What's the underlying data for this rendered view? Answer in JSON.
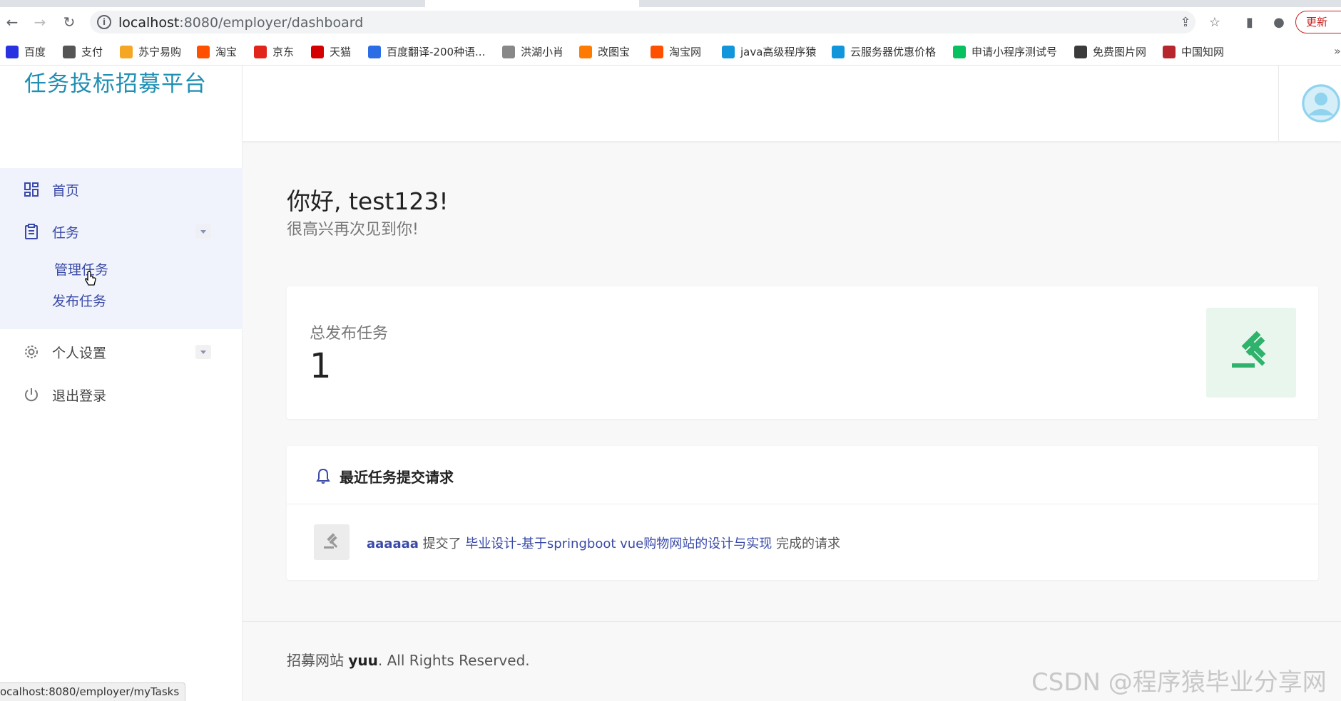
{
  "browser": {
    "url_host": "localhost",
    "url_path": ":8080/employer/dashboard",
    "update_label": "更新",
    "bookmarks": [
      {
        "label": "百度",
        "color": "#2932e1"
      },
      {
        "label": "支付",
        "color": "#555555"
      },
      {
        "label": "苏宁易购",
        "color": "#f5a623"
      },
      {
        "label": "淘宝",
        "color": "#ff5000"
      },
      {
        "label": "京东",
        "color": "#e1251b"
      },
      {
        "label": "天猫",
        "color": "#d40000"
      },
      {
        "label": "百度翻译-200种语...",
        "color": "#2b6de5"
      },
      {
        "label": "洪湖小肖",
        "color": "#888888"
      },
      {
        "label": "改图宝",
        "color": "#ff7a00"
      },
      {
        "label": "淘宝网",
        "color": "#ff5000"
      },
      {
        "label": "java高级程序猿",
        "color": "#1296db"
      },
      {
        "label": "云服务器优惠价格",
        "color": "#1296db"
      },
      {
        "label": "申请小程序测试号",
        "color": "#07c160"
      },
      {
        "label": "免费图片网",
        "color": "#3b3b3b"
      },
      {
        "label": "中国知网",
        "color": "#b8262d"
      }
    ],
    "more_label": "»",
    "status_url": "ocalhost:8080/employer/myTasks"
  },
  "header": {
    "logo": "任务投标招募平台"
  },
  "sidebar": {
    "items": [
      {
        "label": "首页",
        "icon": "dashboard-icon"
      },
      {
        "label": "任务",
        "icon": "clipboard-icon"
      },
      {
        "label": "个人设置",
        "icon": "gear-icon"
      },
      {
        "label": "退出登录",
        "icon": "power-icon"
      }
    ],
    "task_sub": [
      {
        "label": "管理任务"
      },
      {
        "label": "发布任务"
      }
    ]
  },
  "main": {
    "greeting": "你好, test123!",
    "subgreeting": "很高兴再次见到你!",
    "stat": {
      "label": "总发布任务",
      "value": "1"
    },
    "requests": {
      "title": "最近任务提交请求",
      "items": [
        {
          "user": "aaaaaa",
          "verb": "提交了",
          "task": "毕业设计-基于springboot vue购物网站的设计与实现",
          "suffix": "完成的请求"
        }
      ]
    },
    "footer": {
      "prefix": "招募网站",
      "brand": "yuu",
      "suffix": ". All Rights Reserved."
    }
  },
  "watermark": "CSDN @程序猿毕业分享网",
  "colors": {
    "accent": "#3a4aa8",
    "logo": "#1f8fb3",
    "success": "#2fb26b"
  }
}
